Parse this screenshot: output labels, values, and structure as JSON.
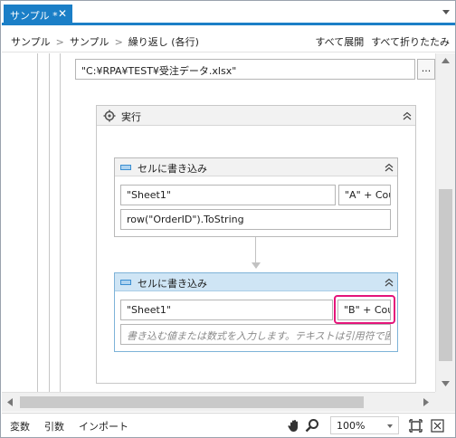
{
  "tab": {
    "title": "サンプル *",
    "close": "✕"
  },
  "breadcrumb": {
    "items": [
      "サンプル",
      "サンプル",
      "繰り返し (各行)"
    ],
    "separator": ">",
    "expand_all": "すべて展開",
    "collapse_all": "すべて折りたたみ"
  },
  "workflow": {
    "path_value": "\"C:¥RPA¥TEST¥受注データ.xlsx\"",
    "browse_label": "...",
    "sequence_title": "実行",
    "activities": [
      {
        "title": "セルに書き込み",
        "sheet": "\"Sheet1\"",
        "cell": "\"A\" + Cou",
        "value": "row(\"OrderID\").ToString",
        "value_is_placeholder": false
      },
      {
        "title": "セルに書き込み",
        "sheet": "\"Sheet1\"",
        "cell": "\"B\" + Cou",
        "value": "書き込む値または数式を入力します。テキストは引用符で囲む",
        "value_is_placeholder": true
      }
    ]
  },
  "statusbar": {
    "variables": "変数",
    "arguments": "引数",
    "imports": "インポート",
    "zoom": "100%"
  },
  "colors": {
    "accent": "#1b7fc7",
    "highlight": "#e4157a",
    "selected_header": "#cfe5f5"
  },
  "icons": [
    "close-icon",
    "dropdown-icon",
    "chevron-right-icon",
    "gear-icon",
    "collapse-chevron-icon",
    "activity-icon",
    "hand-icon",
    "zoom-icon",
    "fit-icon",
    "overview-icon"
  ]
}
